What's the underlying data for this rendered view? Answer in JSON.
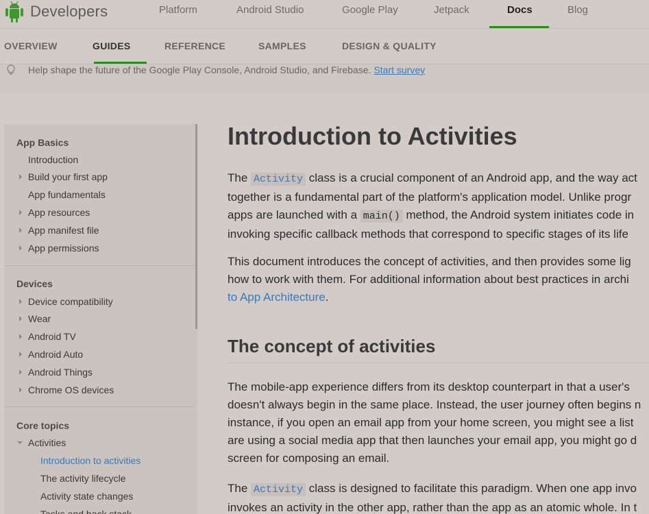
{
  "header": {
    "brand": "Developers",
    "nav": [
      {
        "label": "Platform"
      },
      {
        "label": "Android Studio"
      },
      {
        "label": "Google Play"
      },
      {
        "label": "Jetpack"
      },
      {
        "label": "Docs",
        "active": true
      },
      {
        "label": "Blog"
      }
    ],
    "accent_color": "#2c8a1e"
  },
  "subnav": [
    {
      "label": "OVERVIEW"
    },
    {
      "label": "GUIDES",
      "active": true
    },
    {
      "label": "REFERENCE"
    },
    {
      "label": "SAMPLES"
    },
    {
      "label": "DESIGN & QUALITY"
    }
  ],
  "banner": {
    "icon": "lightbulb-icon",
    "text": "Help shape the future of the Google Play Console, Android Studio, and Firebase.",
    "link": "Start survey"
  },
  "sidebar": {
    "sections": [
      {
        "heading": "App Basics",
        "items": [
          {
            "label": "Introduction",
            "expandable": false
          },
          {
            "label": "Build your first app",
            "expandable": true
          },
          {
            "label": "App fundamentals",
            "expandable": false
          },
          {
            "label": "App resources",
            "expandable": true
          },
          {
            "label": "App manifest file",
            "expandable": true
          },
          {
            "label": "App permissions",
            "expandable": true
          }
        ]
      },
      {
        "heading": "Devices",
        "items": [
          {
            "label": "Device compatibility",
            "expandable": true
          },
          {
            "label": "Wear",
            "expandable": true
          },
          {
            "label": "Android TV",
            "expandable": true
          },
          {
            "label": "Android Auto",
            "expandable": true
          },
          {
            "label": "Android Things",
            "expandable": true
          },
          {
            "label": "Chrome OS devices",
            "expandable": true
          }
        ]
      },
      {
        "heading": "Core topics",
        "items": [
          {
            "label": "Activities",
            "expanded": true
          },
          {
            "label": "Introduction to activities",
            "active": true
          },
          {
            "label": "The activity lifecycle"
          },
          {
            "label": "Activity state changes"
          },
          {
            "label": "Tasks and back stack"
          }
        ]
      }
    ]
  },
  "content": {
    "title": "Introduction to Activities",
    "p1": {
      "l1_a": "The ",
      "l1_code": "Activity",
      "l1_b": " class is a crucial component of an Android app, and the way act",
      "l2": "together is a fundamental part of the platform's application model. Unlike progr",
      "l3_a": "apps are launched with a ",
      "l3_code": "main()",
      "l3_b": " method, the Android system initiates code in",
      "l4": "invoking specific callback methods that correspond to specific stages of its life"
    },
    "p2": {
      "l1": "This document introduces the concept of activities, and then provides some lig",
      "l2": "how to work with them. For additional information about best practices in archi",
      "l3_link": "to App Architecture",
      "l3_b": "."
    },
    "h2": "The concept of activities",
    "p3": {
      "l1": "The mobile-app experience differs from its desktop counterpart in that a user's",
      "l2": "doesn't always begin in the same place. Instead, the user journey often begins n",
      "l3": "instance, if you open an email app from your home screen, you might see a list",
      "l4": "are using a social media app that then launches your email app, you might go d",
      "l5": "screen for composing an email."
    },
    "p4": {
      "l1_a": "The ",
      "l1_code": "Activity",
      "l1_b": " class is designed to facilitate this paradigm. When one app invo",
      "l2": "invokes an activity in the other app, rather than the app as an atomic whole. In t"
    }
  }
}
